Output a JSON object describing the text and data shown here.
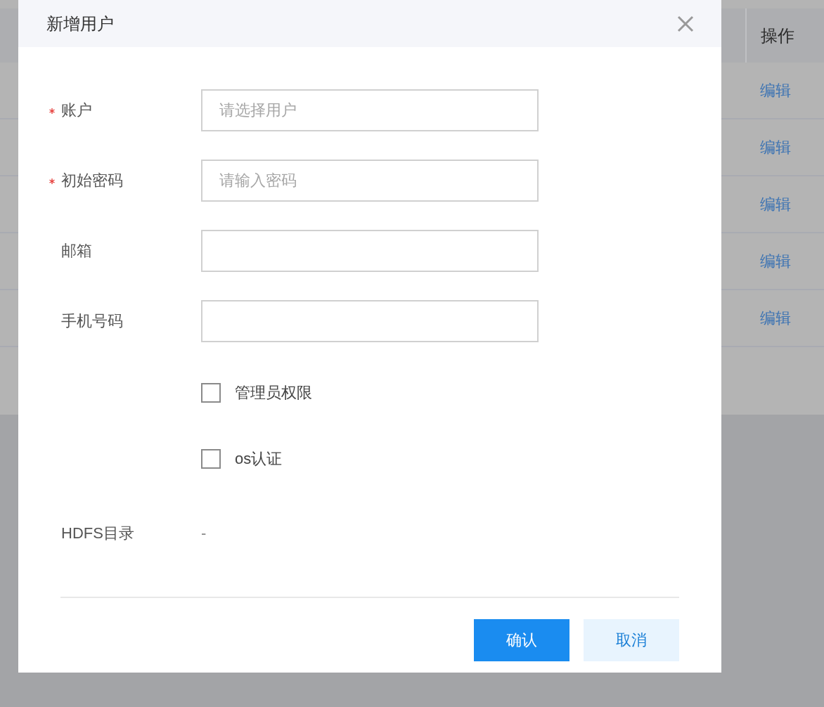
{
  "background_table": {
    "column_header": "操作",
    "rows": [
      {
        "action": "编辑"
      },
      {
        "action": "编辑"
      },
      {
        "action": "编辑"
      },
      {
        "action": "编辑"
      },
      {
        "action": "编辑"
      }
    ]
  },
  "dialog": {
    "title": "新增用户",
    "fields": [
      {
        "label": "账户",
        "required": true,
        "placeholder": "请选择用户"
      },
      {
        "label": "初始密码",
        "required": true,
        "placeholder": "请输入密码"
      },
      {
        "label": "邮箱",
        "required": false
      },
      {
        "label": "手机号码",
        "required": false
      }
    ],
    "checkboxes": [
      {
        "label": "管理员权限",
        "checked": false
      },
      {
        "label": "os认证",
        "checked": false
      }
    ],
    "hdfs": {
      "label": "HDFS目录",
      "value": "-"
    },
    "buttons": [
      {
        "label": "确认",
        "kind": "primary"
      },
      {
        "label": "取消",
        "kind": "secondary"
      }
    ]
  }
}
